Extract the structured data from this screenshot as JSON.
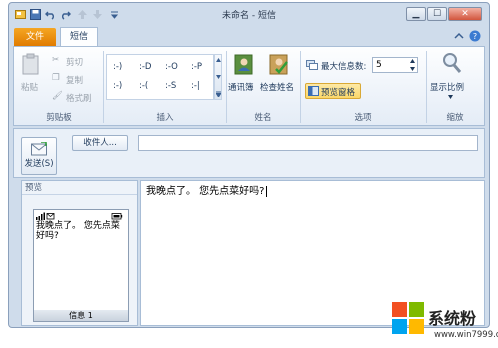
{
  "window": {
    "title": "未命名 - 短信"
  },
  "title_buttons": {
    "minimize": "▁",
    "maximize": "☐",
    "close": "✕"
  },
  "tabs": [
    {
      "label": "文件"
    },
    {
      "label": "短信"
    }
  ],
  "ribbon": {
    "clipboard": {
      "label": "剪贴板",
      "paste": "粘贴",
      "cut": "剪切",
      "copy": "复制",
      "format_painter": "格式刷"
    },
    "insert": {
      "label": "插入",
      "emoticons": [
        ":-)",
        ":-D",
        ":-O",
        ":-P",
        ":-)",
        ":-(",
        ":-S",
        ":-|"
      ]
    },
    "names": {
      "label": "姓名",
      "address_book": "通讯簿",
      "check_names": "检查姓名"
    },
    "options": {
      "label": "选项",
      "max_messages_label": "最大信息数:",
      "max_messages_value": "5",
      "preview_pane": "预览窗格"
    },
    "zoom": {
      "label": "缩放",
      "zoom_label": "显示比例"
    }
  },
  "compose": {
    "send_label": "发送(S)",
    "recipients_label": "收件人...",
    "recipients_value": ""
  },
  "preview": {
    "title": "预览",
    "phone_text": "我晚点了。 您先点菜好吗?",
    "footer": "信息 1"
  },
  "editor": {
    "text": "我晚点了。 您先点菜好吗?"
  },
  "watermark": {
    "text": "系统粉",
    "url": "www.win7999.com"
  },
  "colors": {
    "file_tab": "#e98a0a",
    "ribbon_bg": "#e4ecf6",
    "frame": "#cfdceb",
    "accent_yellow": "#fbd86a"
  },
  "icons": [
    "paste-icon",
    "scissors-icon",
    "copy-icon",
    "format-painter-icon",
    "address-book-icon",
    "check-names-icon",
    "preview-pane-icon",
    "zoom-icon",
    "send-icon",
    "help-icon",
    "windows-logo-icon"
  ]
}
